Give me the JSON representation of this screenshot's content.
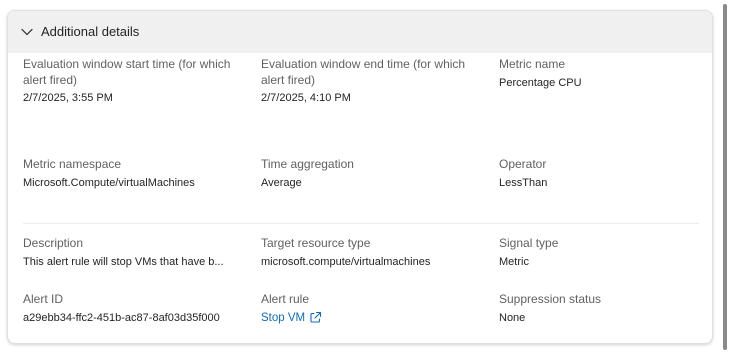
{
  "section": {
    "title": "Additional details"
  },
  "fields": {
    "eval_start": {
      "label": "Evaluation window start time (for which alert fired)",
      "value": "2/7/2025, 3:55 PM"
    },
    "eval_end": {
      "label": "Evaluation window end time (for which alert fired)",
      "value": "2/7/2025, 4:10 PM"
    },
    "metric_name": {
      "label": "Metric name",
      "value": "Percentage CPU"
    },
    "metric_namespace": {
      "label": "Metric namespace",
      "value": "Microsoft.Compute/virtualMachines"
    },
    "time_aggregation": {
      "label": "Time aggregation",
      "value": "Average"
    },
    "operator": {
      "label": "Operator",
      "value": "LessThan"
    },
    "description": {
      "label": "Description",
      "value": "This alert rule will stop VMs that have b..."
    },
    "target_resource_type": {
      "label": "Target resource type",
      "value": "microsoft.compute/virtualmachines"
    },
    "signal_type": {
      "label": "Signal type",
      "value": "Metric"
    },
    "alert_id": {
      "label": "Alert ID",
      "value": "a29ebb34-ffc2-451b-ac87-8af03d35f000"
    },
    "alert_rule": {
      "label": "Alert rule",
      "value": "Stop VM"
    },
    "suppression_status": {
      "label": "Suppression status",
      "value": "None"
    }
  },
  "icons": {
    "collapse": "chevron-down-icon",
    "open_external": "open-external-icon"
  },
  "colors": {
    "link": "#0f6cbd",
    "header_bg": "#f0f0f0",
    "label": "#616161"
  }
}
